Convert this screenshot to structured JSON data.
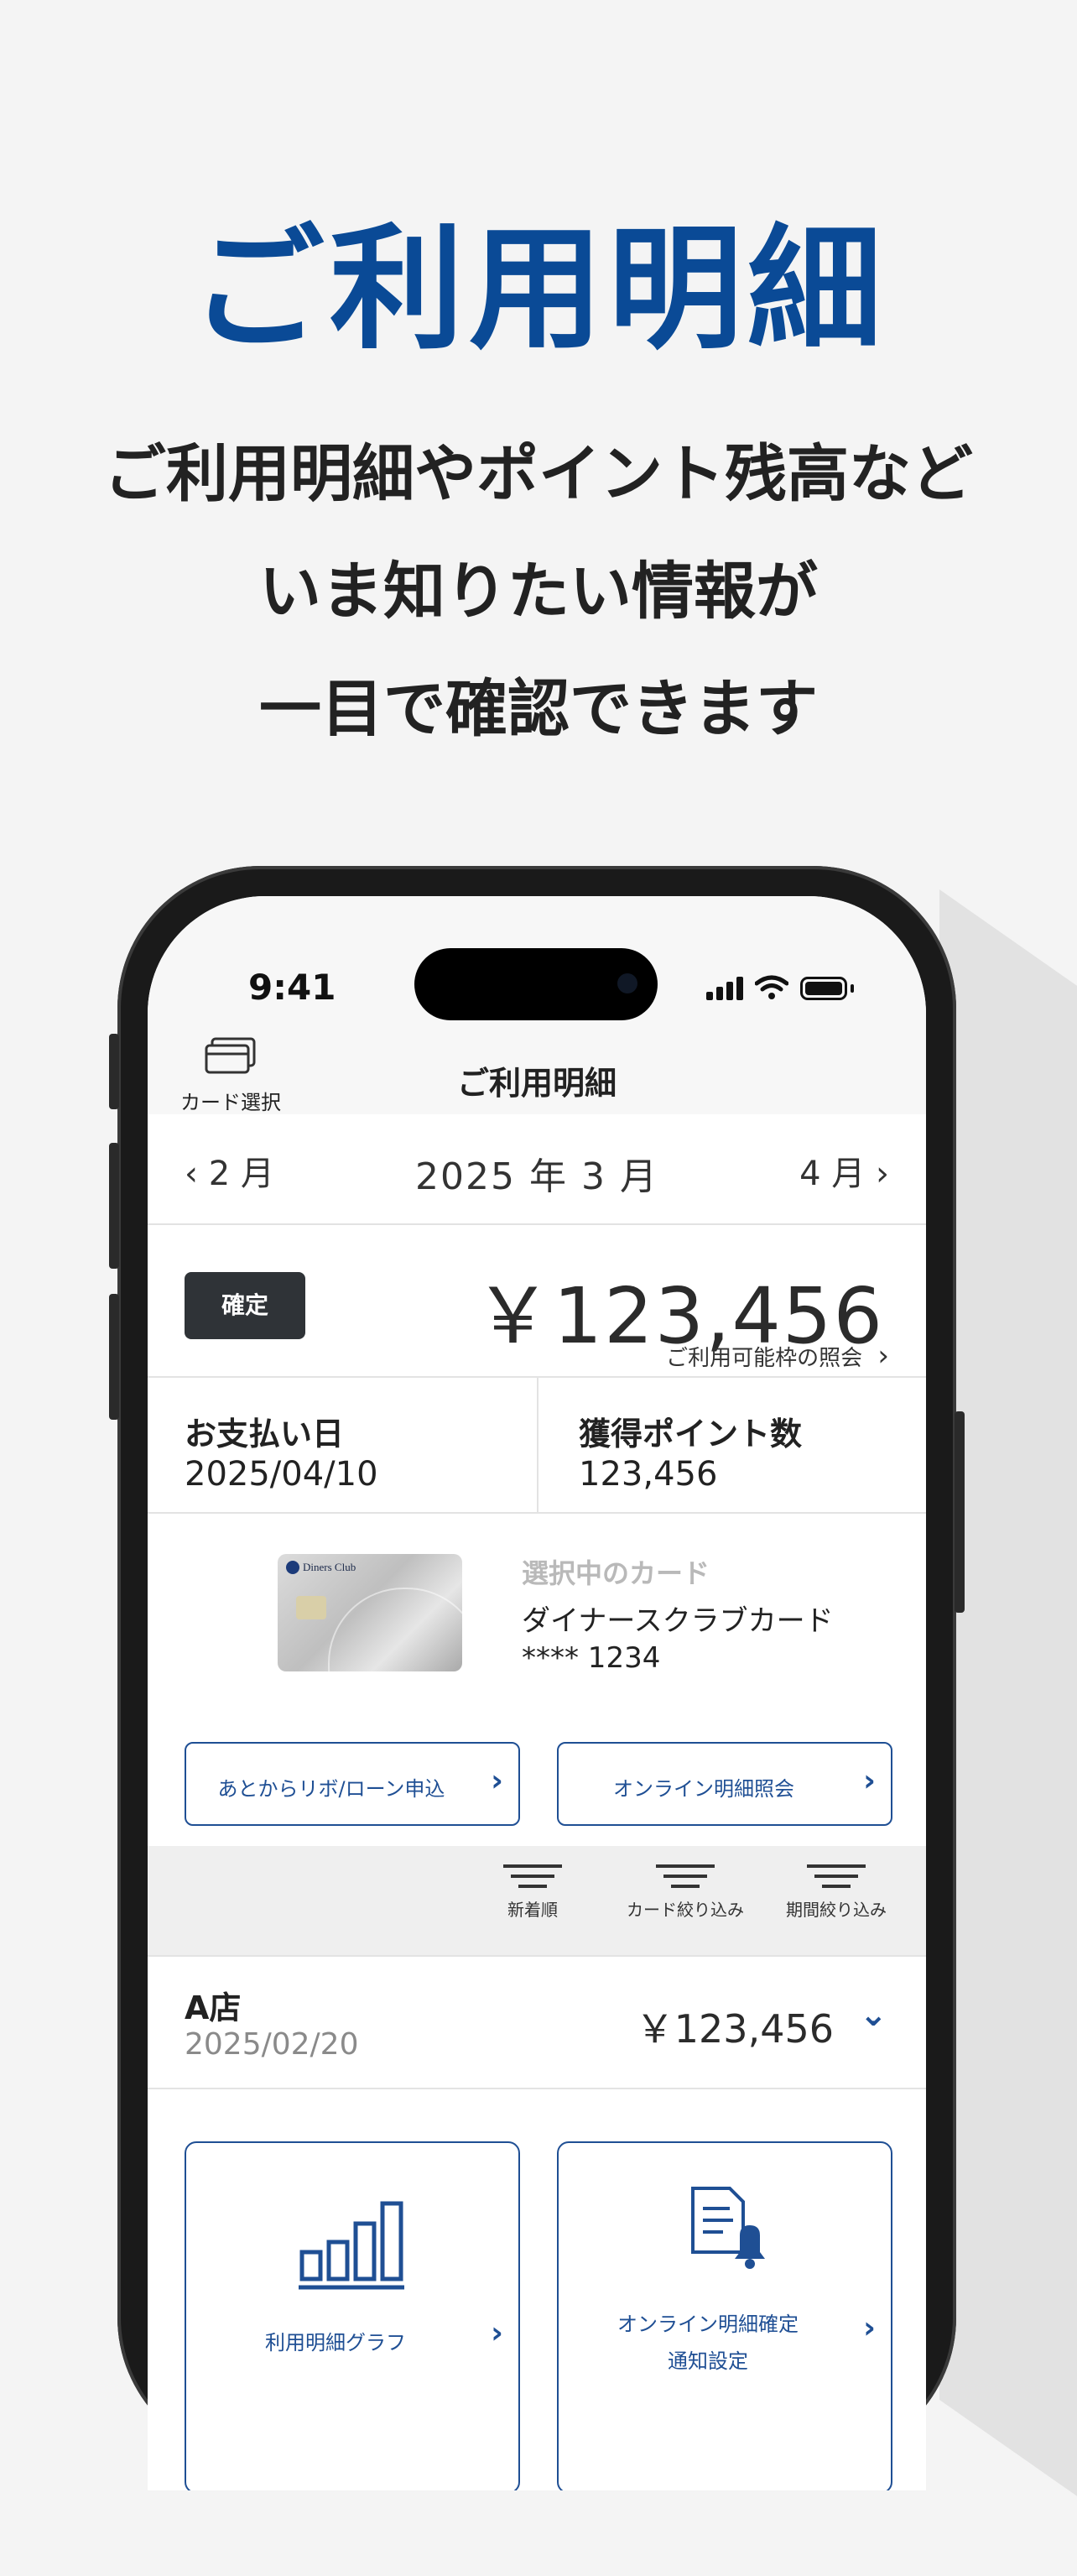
{
  "promo": {
    "headline": "ご利用明細",
    "line1": "ご利用明細やポイント残高など",
    "line2": "いま知りたい情報が",
    "line3": "一目で確認できます"
  },
  "status_bar": {
    "time": "9:41"
  },
  "header": {
    "card_select_label": "カード選択",
    "title": "ご利用明細"
  },
  "month_nav": {
    "prev": "2 月",
    "current": "2025 年 3 月",
    "next": "4 月"
  },
  "summary": {
    "status_badge": "確定",
    "total": "￥123,456",
    "limit_link": "ご利用可能枠の照会"
  },
  "info": {
    "pay_date_label": "お支払い日",
    "pay_date": "2025/04/10",
    "points_label": "獲得ポイント数",
    "points": "123,456"
  },
  "card": {
    "brand_text": "Diners Club",
    "selected_label": "選択中のカード",
    "name": "ダイナースクラブカード",
    "number": "**** 1234"
  },
  "actions": {
    "revo_loan": "あとからリボ/ローン申込",
    "online_statement": "オンライン明細照会"
  },
  "filters": [
    {
      "label": "新着順"
    },
    {
      "label": "カード絞り込み"
    },
    {
      "label": "期間絞り込み"
    }
  ],
  "transactions": [
    {
      "shop": "A店",
      "date": "2025/02/20",
      "amount": "￥123,456"
    }
  ],
  "tiles": {
    "graph": "利用明細グラフ",
    "notify_line1": "オンライン明細確定",
    "notify_line2": "通知設定"
  },
  "colors": {
    "brand_blue": "#0a4a96",
    "accent_blue": "#1f4f94",
    "badge_dark": "#2f3337"
  }
}
